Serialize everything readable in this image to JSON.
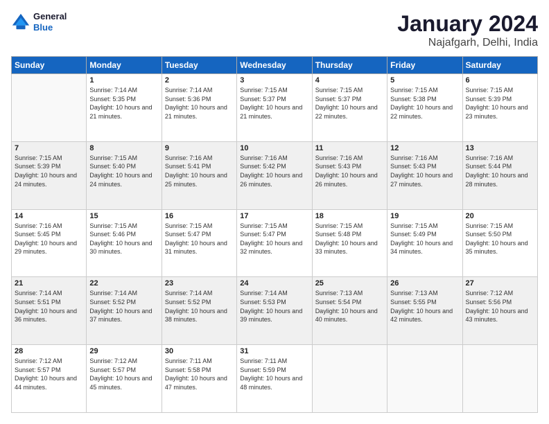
{
  "logo": {
    "line1": "General",
    "line2": "Blue"
  },
  "title": "January 2024",
  "subtitle": "Najafgarh, Delhi, India",
  "days_of_week": [
    "Sunday",
    "Monday",
    "Tuesday",
    "Wednesday",
    "Thursday",
    "Friday",
    "Saturday"
  ],
  "weeks": [
    [
      {
        "day": "",
        "sunrise": "",
        "sunset": "",
        "daylight": ""
      },
      {
        "day": "1",
        "sunrise": "Sunrise: 7:14 AM",
        "sunset": "Sunset: 5:35 PM",
        "daylight": "Daylight: 10 hours and 21 minutes."
      },
      {
        "day": "2",
        "sunrise": "Sunrise: 7:14 AM",
        "sunset": "Sunset: 5:36 PM",
        "daylight": "Daylight: 10 hours and 21 minutes."
      },
      {
        "day": "3",
        "sunrise": "Sunrise: 7:15 AM",
        "sunset": "Sunset: 5:37 PM",
        "daylight": "Daylight: 10 hours and 21 minutes."
      },
      {
        "day": "4",
        "sunrise": "Sunrise: 7:15 AM",
        "sunset": "Sunset: 5:37 PM",
        "daylight": "Daylight: 10 hours and 22 minutes."
      },
      {
        "day": "5",
        "sunrise": "Sunrise: 7:15 AM",
        "sunset": "Sunset: 5:38 PM",
        "daylight": "Daylight: 10 hours and 22 minutes."
      },
      {
        "day": "6",
        "sunrise": "Sunrise: 7:15 AM",
        "sunset": "Sunset: 5:39 PM",
        "daylight": "Daylight: 10 hours and 23 minutes."
      }
    ],
    [
      {
        "day": "7",
        "sunrise": "Sunrise: 7:15 AM",
        "sunset": "Sunset: 5:39 PM",
        "daylight": "Daylight: 10 hours and 24 minutes."
      },
      {
        "day": "8",
        "sunrise": "Sunrise: 7:15 AM",
        "sunset": "Sunset: 5:40 PM",
        "daylight": "Daylight: 10 hours and 24 minutes."
      },
      {
        "day": "9",
        "sunrise": "Sunrise: 7:16 AM",
        "sunset": "Sunset: 5:41 PM",
        "daylight": "Daylight: 10 hours and 25 minutes."
      },
      {
        "day": "10",
        "sunrise": "Sunrise: 7:16 AM",
        "sunset": "Sunset: 5:42 PM",
        "daylight": "Daylight: 10 hours and 26 minutes."
      },
      {
        "day": "11",
        "sunrise": "Sunrise: 7:16 AM",
        "sunset": "Sunset: 5:43 PM",
        "daylight": "Daylight: 10 hours and 26 minutes."
      },
      {
        "day": "12",
        "sunrise": "Sunrise: 7:16 AM",
        "sunset": "Sunset: 5:43 PM",
        "daylight": "Daylight: 10 hours and 27 minutes."
      },
      {
        "day": "13",
        "sunrise": "Sunrise: 7:16 AM",
        "sunset": "Sunset: 5:44 PM",
        "daylight": "Daylight: 10 hours and 28 minutes."
      }
    ],
    [
      {
        "day": "14",
        "sunrise": "Sunrise: 7:16 AM",
        "sunset": "Sunset: 5:45 PM",
        "daylight": "Daylight: 10 hours and 29 minutes."
      },
      {
        "day": "15",
        "sunrise": "Sunrise: 7:15 AM",
        "sunset": "Sunset: 5:46 PM",
        "daylight": "Daylight: 10 hours and 30 minutes."
      },
      {
        "day": "16",
        "sunrise": "Sunrise: 7:15 AM",
        "sunset": "Sunset: 5:47 PM",
        "daylight": "Daylight: 10 hours and 31 minutes."
      },
      {
        "day": "17",
        "sunrise": "Sunrise: 7:15 AM",
        "sunset": "Sunset: 5:47 PM",
        "daylight": "Daylight: 10 hours and 32 minutes."
      },
      {
        "day": "18",
        "sunrise": "Sunrise: 7:15 AM",
        "sunset": "Sunset: 5:48 PM",
        "daylight": "Daylight: 10 hours and 33 minutes."
      },
      {
        "day": "19",
        "sunrise": "Sunrise: 7:15 AM",
        "sunset": "Sunset: 5:49 PM",
        "daylight": "Daylight: 10 hours and 34 minutes."
      },
      {
        "day": "20",
        "sunrise": "Sunrise: 7:15 AM",
        "sunset": "Sunset: 5:50 PM",
        "daylight": "Daylight: 10 hours and 35 minutes."
      }
    ],
    [
      {
        "day": "21",
        "sunrise": "Sunrise: 7:14 AM",
        "sunset": "Sunset: 5:51 PM",
        "daylight": "Daylight: 10 hours and 36 minutes."
      },
      {
        "day": "22",
        "sunrise": "Sunrise: 7:14 AM",
        "sunset": "Sunset: 5:52 PM",
        "daylight": "Daylight: 10 hours and 37 minutes."
      },
      {
        "day": "23",
        "sunrise": "Sunrise: 7:14 AM",
        "sunset": "Sunset: 5:52 PM",
        "daylight": "Daylight: 10 hours and 38 minutes."
      },
      {
        "day": "24",
        "sunrise": "Sunrise: 7:14 AM",
        "sunset": "Sunset: 5:53 PM",
        "daylight": "Daylight: 10 hours and 39 minutes."
      },
      {
        "day": "25",
        "sunrise": "Sunrise: 7:13 AM",
        "sunset": "Sunset: 5:54 PM",
        "daylight": "Daylight: 10 hours and 40 minutes."
      },
      {
        "day": "26",
        "sunrise": "Sunrise: 7:13 AM",
        "sunset": "Sunset: 5:55 PM",
        "daylight": "Daylight: 10 hours and 42 minutes."
      },
      {
        "day": "27",
        "sunrise": "Sunrise: 7:12 AM",
        "sunset": "Sunset: 5:56 PM",
        "daylight": "Daylight: 10 hours and 43 minutes."
      }
    ],
    [
      {
        "day": "28",
        "sunrise": "Sunrise: 7:12 AM",
        "sunset": "Sunset: 5:57 PM",
        "daylight": "Daylight: 10 hours and 44 minutes."
      },
      {
        "day": "29",
        "sunrise": "Sunrise: 7:12 AM",
        "sunset": "Sunset: 5:57 PM",
        "daylight": "Daylight: 10 hours and 45 minutes."
      },
      {
        "day": "30",
        "sunrise": "Sunrise: 7:11 AM",
        "sunset": "Sunset: 5:58 PM",
        "daylight": "Daylight: 10 hours and 47 minutes."
      },
      {
        "day": "31",
        "sunrise": "Sunrise: 7:11 AM",
        "sunset": "Sunset: 5:59 PM",
        "daylight": "Daylight: 10 hours and 48 minutes."
      },
      {
        "day": "",
        "sunrise": "",
        "sunset": "",
        "daylight": ""
      },
      {
        "day": "",
        "sunrise": "",
        "sunset": "",
        "daylight": ""
      },
      {
        "day": "",
        "sunrise": "",
        "sunset": "",
        "daylight": ""
      }
    ]
  ]
}
